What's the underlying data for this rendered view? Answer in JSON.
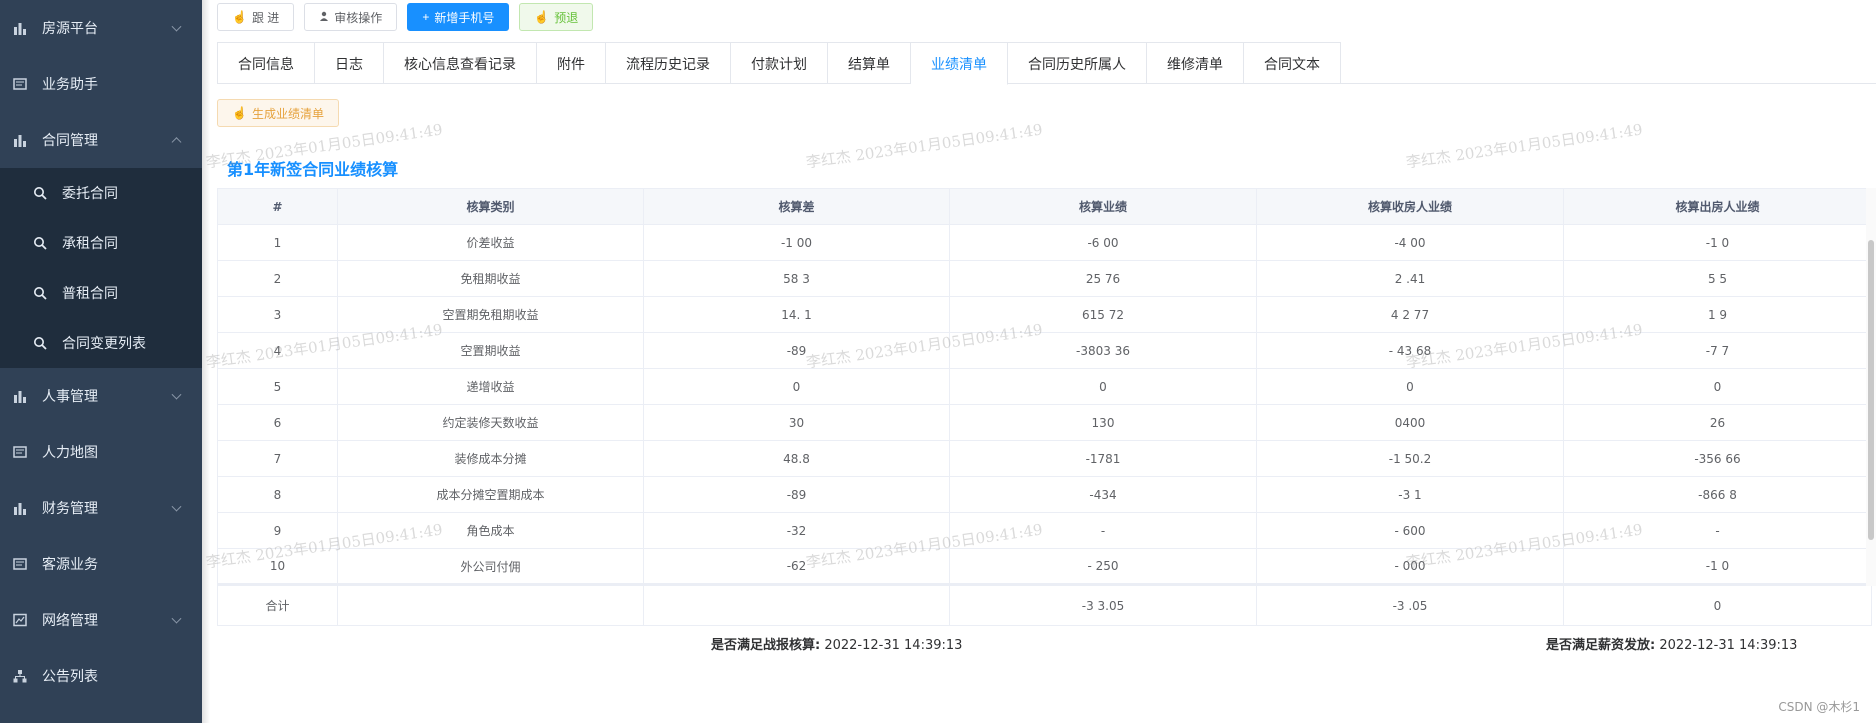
{
  "sidebar": {
    "items": [
      {
        "label": "房源平台",
        "icon": "bar-chart-icon",
        "expandable": true
      },
      {
        "label": "业务助手",
        "icon": "form-icon",
        "expandable": false
      },
      {
        "label": "合同管理",
        "icon": "bar-chart-icon",
        "expandable": true,
        "expanded": true
      },
      {
        "label": "人事管理",
        "icon": "bar-chart-icon",
        "expandable": true
      },
      {
        "label": "人力地图",
        "icon": "form-icon",
        "expandable": false
      },
      {
        "label": "财务管理",
        "icon": "bar-chart-icon",
        "expandable": true
      },
      {
        "label": "客源业务",
        "icon": "form-icon",
        "expandable": false
      },
      {
        "label": "网络管理",
        "icon": "picture-icon",
        "expandable": true
      },
      {
        "label": "公告列表",
        "icon": "tree-icon",
        "expandable": false
      }
    ],
    "submenu": [
      {
        "label": "委托合同"
      },
      {
        "label": "承租合同"
      },
      {
        "label": "普租合同"
      },
      {
        "label": "合同变更列表"
      }
    ]
  },
  "toolbar": {
    "follow_label": "跟 进",
    "audit_label": "审核操作",
    "add_phone_label": "新增手机号",
    "refund_label": "预退"
  },
  "tabs": [
    {
      "label": "合同信息"
    },
    {
      "label": "日志"
    },
    {
      "label": "核心信息查看记录"
    },
    {
      "label": "附件"
    },
    {
      "label": "流程历史记录"
    },
    {
      "label": "付款计划"
    },
    {
      "label": "结算单"
    },
    {
      "label": "业绩清单",
      "active": true
    },
    {
      "label": "合同历史所属人"
    },
    {
      "label": "维修清单"
    },
    {
      "label": "合同文本"
    }
  ],
  "generate_label": "生成业绩清单",
  "section_title": "第1年新签合同业绩核算",
  "table": {
    "headers": [
      "#",
      "核算类别",
      "核算差",
      "核算业绩",
      "核算收房人业绩",
      "核算出房人业绩"
    ],
    "rows": [
      [
        "1",
        "价差收益",
        "-1 00",
        "-6 00",
        "-4 00",
        "-1 0"
      ],
      [
        "2",
        "免租期收益",
        "58 3",
        "25 76",
        "2 .41",
        "5 5"
      ],
      [
        "3",
        "空置期免租期收益",
        "14. 1",
        "615 72",
        "4 2 77",
        "1 9"
      ],
      [
        "4",
        "空置期收益",
        "-89",
        "-3803 36",
        "- 43 68",
        "-7 7"
      ],
      [
        "5",
        "递增收益",
        "0",
        "0",
        "0",
        "0"
      ],
      [
        "6",
        "约定装修天数收益",
        "30",
        "130",
        "0400",
        "26"
      ],
      [
        "7",
        "装修成本分摊",
        "48.8",
        "-1781",
        "-1 50.2",
        "-356 66"
      ],
      [
        "8",
        "成本分摊空置期成本",
        "-89",
        "-434",
        "-3 1",
        "-866 8"
      ],
      [
        "9",
        "角色成本",
        "-32",
        "-",
        "- 600",
        "-"
      ],
      [
        "10",
        "外公司付佣",
        "-62",
        "- 250",
        "- 000",
        "-1 0"
      ]
    ],
    "total": [
      "合计",
      "",
      "",
      "-3 3.05",
      "-3 .05",
      "0"
    ]
  },
  "footer": {
    "left_label": "是否满足战报核算:",
    "left_value": "2022-12-31 14:39:13",
    "right_label": "是否满足薪资发放:",
    "right_value": "2022-12-31 14:39:13"
  },
  "watermark_text": "李红杰 2023年01月05日09:41:49",
  "credit": "CSDN @木杉1",
  "colors": {
    "sidebar_bg": "#304156",
    "submenu_bg": "#1f2d3d",
    "primary": "#1890ff",
    "success": "#67c23a",
    "warning": "#e6a23c"
  }
}
